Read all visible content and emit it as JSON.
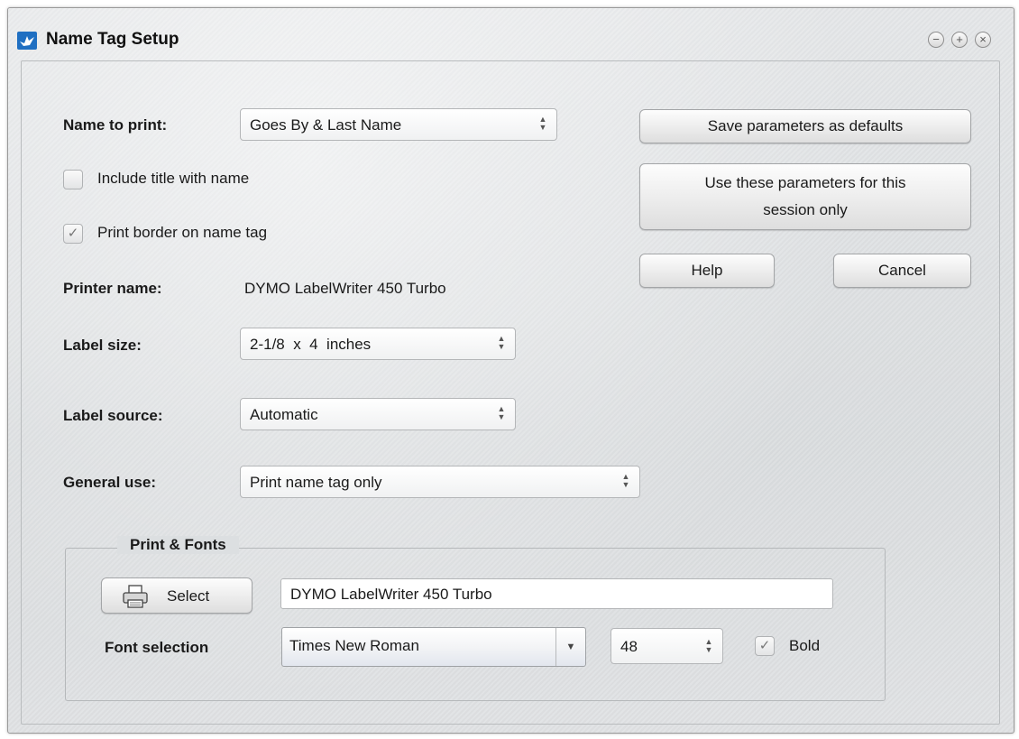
{
  "window": {
    "title": "Name Tag Setup",
    "controls": {
      "minimize": "−",
      "maximize": "+",
      "close": "×"
    }
  },
  "name_to_print": {
    "label": "Name to print:",
    "value": "Goes By & Last Name"
  },
  "include_title": {
    "label": "Include title with name",
    "checked": false
  },
  "print_border": {
    "label": "Print border on name tag",
    "checked": true
  },
  "printer_name": {
    "label": "Printer name:",
    "value": "DYMO LabelWriter 450 Turbo"
  },
  "label_size": {
    "label": "Label size:",
    "value": "2-1/8  x  4  inches"
  },
  "label_source": {
    "label": "Label source:",
    "value": "Automatic"
  },
  "general_use": {
    "label": "General use:",
    "value": "Print name tag only"
  },
  "buttons": {
    "save_defaults": "Save parameters as defaults",
    "session_line1": "Use these parameters for this",
    "session_line2": "session only",
    "help": "Help",
    "cancel": "Cancel"
  },
  "print_fonts": {
    "legend": "Print & Fonts",
    "select_button": "Select",
    "printer_field": "DYMO LabelWriter 450 Turbo",
    "font_label": "Font selection",
    "font_value": "Times New Roman",
    "size_value": "48",
    "bold_label": "Bold",
    "bold_checked": true
  },
  "icons": {
    "app": "dove-icon",
    "spin": "up-down-spinner-icon",
    "printer": "printer-icon",
    "check": "checkmark-icon"
  },
  "spinner": {
    "up": "▲",
    "down": "▼"
  },
  "check_glyph": "✓",
  "combo_glyph": "▼"
}
